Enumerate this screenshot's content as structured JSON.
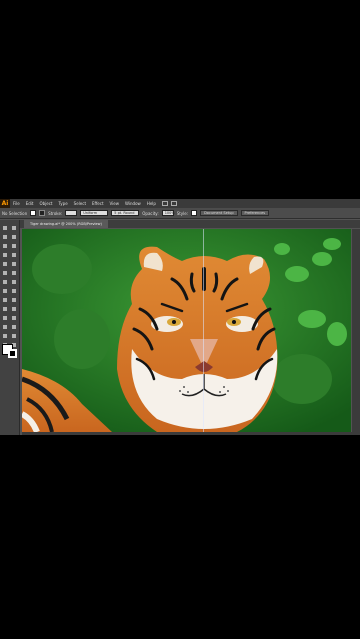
{
  "app": {
    "logo": "Ai",
    "menus": [
      "File",
      "Edit",
      "Object",
      "Type",
      "Select",
      "Effect",
      "View",
      "Window",
      "Help"
    ]
  },
  "control_bar": {
    "selection_label": "No Selection",
    "stroke_label": "Stroke:",
    "brush_dropdown": "Uniform",
    "style_dropdown": "5 pt. Round",
    "opacity_label": "Opacity:",
    "opacity_value": "100%",
    "style_label": "Style:",
    "document_setup": "Document Setup",
    "preferences": "Preferences"
  },
  "document": {
    "tab_label": "Tiger drawing.ai* @ 200% (RGB/Preview)"
  },
  "colors": {
    "ui_dark": "#3a3a3a",
    "ui_mid": "#535353",
    "logo_orange": "#ff9a00",
    "foliage": "#2f8a2c",
    "tiger_orange": "#d97a2b"
  },
  "tools": [
    "selection-tool",
    "direct-selection-tool",
    "magic-wand-tool",
    "lasso-tool",
    "pen-tool",
    "type-tool",
    "line-tool",
    "rectangle-tool",
    "paintbrush-tool",
    "pencil-tool",
    "blob-brush-tool",
    "eraser-tool",
    "rotate-tool",
    "scale-tool",
    "width-tool",
    "free-transform-tool",
    "shape-builder-tool",
    "perspective-grid-tool",
    "mesh-tool",
    "gradient-tool",
    "eyedropper-tool",
    "blend-tool",
    "symbol-sprayer-tool",
    "column-graph-tool",
    "artboard-tool",
    "slice-tool",
    "hand-tool",
    "zoom-tool"
  ]
}
